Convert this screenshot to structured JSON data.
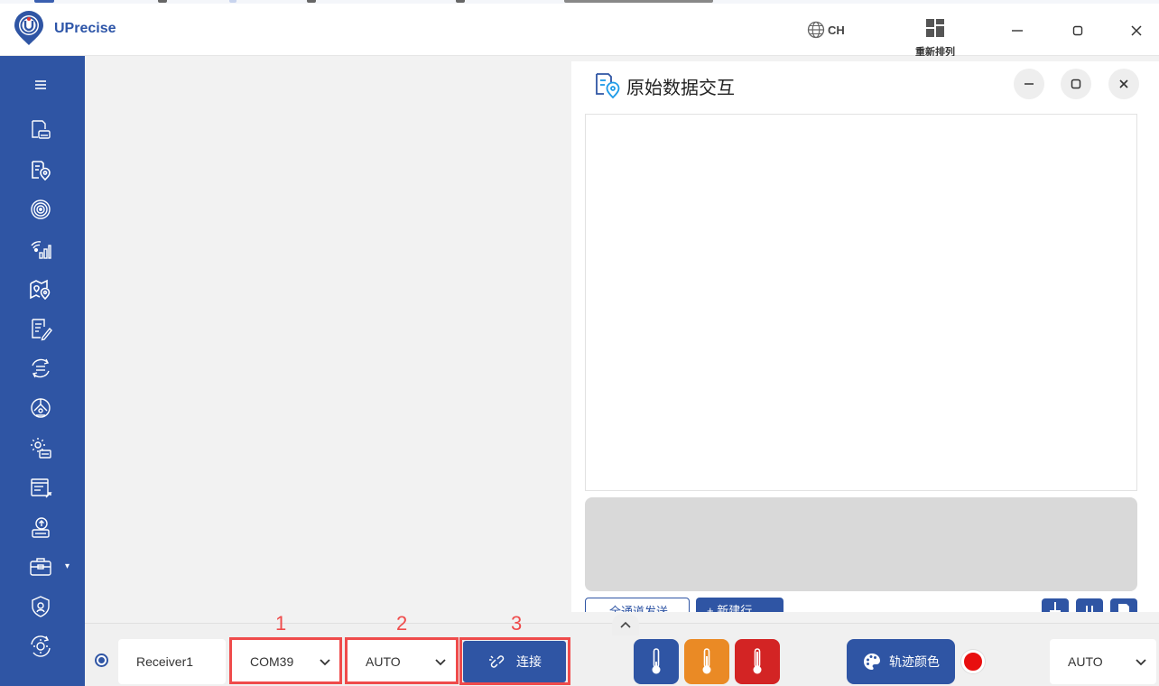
{
  "app": {
    "name": "UPrecise",
    "brand_color": "#2f55a4"
  },
  "titlebar": {
    "lang_icon": "globe-icon",
    "lang_label": "CH",
    "rearrange_icon": "layout-grid-icon",
    "rearrange_label": "重新排列",
    "window_buttons": [
      "minimize-icon",
      "maximize-icon",
      "close-icon"
    ]
  },
  "sidebar": {
    "items": [
      "menu-icon",
      "device-file-icon",
      "location-document-icon",
      "target-icon",
      "signal-bars-icon",
      "map-pin-icon",
      "edit-document-icon",
      "sync-icon",
      "satellite-dish-icon",
      "gear-document-icon",
      "list-upload-icon",
      "cloud-upload-icon",
      "toolbox-icon",
      "security-settings-icon",
      "refresh-gear-icon"
    ]
  },
  "panel": {
    "title": "原始数据交互",
    "title_icon": "location-document-icon",
    "output_text": "",
    "input_text": "",
    "btn_send_all": "全通道发送",
    "btn_new_line": "新建行",
    "mini_buttons": [
      "pin-icon",
      "pause-icon",
      "save-icon"
    ]
  },
  "bottom": {
    "collapse_icon": "chevron-up-icon",
    "receiver": "Receiver1",
    "port": "COM39",
    "baud": "AUTO",
    "connect_label": "连接",
    "connect_icon": "link-icon",
    "annotations": [
      "1",
      "2",
      "3"
    ],
    "annotation_color": "#ef4b4b",
    "temp_buttons": [
      {
        "icon": "thermometer-low-icon",
        "color": "#2f55a4"
      },
      {
        "icon": "thermometer-mid-icon",
        "color": "#ea8a25"
      },
      {
        "icon": "thermometer-high-icon",
        "color": "#d32424"
      }
    ],
    "track_color_label": "轨迹颜色",
    "track_color_icon": "palette-icon",
    "track_color_value": "#e80f0f",
    "mode": "AUTO"
  }
}
